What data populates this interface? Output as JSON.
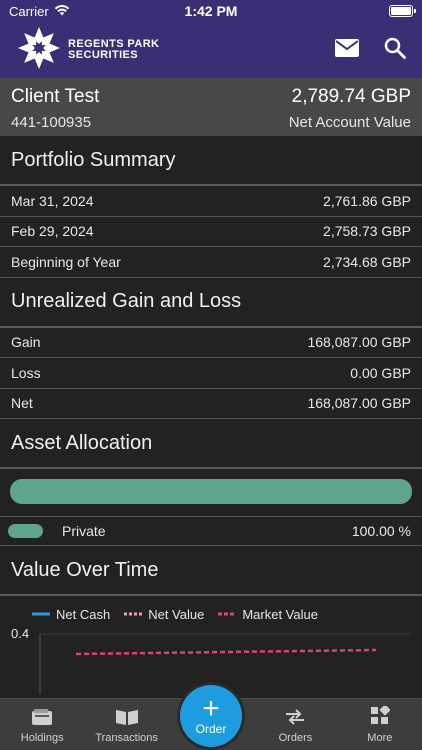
{
  "status": {
    "carrier": "Carrier",
    "time": "1:42 PM"
  },
  "brand": {
    "line1": "REGENTS PARK",
    "line2": "SECURITIES"
  },
  "header": {
    "icons": [
      "mail-icon",
      "search-icon"
    ]
  },
  "client": {
    "name": "Client Test",
    "account_id": "441-100935",
    "value": "2,789.74 GBP",
    "value_caption": "Net Account Value"
  },
  "portfolio": {
    "title": "Portfolio Summary",
    "rows": [
      {
        "label": "Mar 31, 2024",
        "value": "2,761.86 GBP"
      },
      {
        "label": "Feb 29, 2024",
        "value": "2,758.73 GBP"
      },
      {
        "label": "Beginning of Year",
        "value": "2,734.68 GBP"
      }
    ]
  },
  "gain_loss": {
    "title": "Unrealized Gain and Loss",
    "rows": [
      {
        "label": "Gain",
        "value": "168,087.00 GBP"
      },
      {
        "label": "Loss",
        "value": "0.00 GBP"
      },
      {
        "label": "Net",
        "value": "168,087.00 GBP"
      }
    ]
  },
  "allocation": {
    "title": "Asset Allocation",
    "items": [
      {
        "label": "Private",
        "percent": "100.00 %",
        "color": "#5fa58b",
        "fraction": 1.0
      }
    ]
  },
  "value_over_time": {
    "title": "Value Over Time",
    "legend": [
      {
        "label": "Net Cash",
        "color": "#2a9be0",
        "style": "solid"
      },
      {
        "label": "Net Value",
        "color": "#e8a0b4",
        "style": "dotted"
      },
      {
        "label": "Market Value",
        "color": "#e0446a",
        "style": "dashed"
      }
    ],
    "y_tick": "0.4"
  },
  "tabs": [
    {
      "label": "Holdings",
      "icon": "wallet-icon"
    },
    {
      "label": "Transactions",
      "icon": "book-icon"
    },
    {
      "label": "Orders",
      "icon": "arrows-icon"
    },
    {
      "label": "More",
      "icon": "grid-icon"
    }
  ],
  "order_button": {
    "label": "Order",
    "symbol": "+"
  },
  "colors": {
    "brand": "#3a2f74",
    "accent": "#1e9ce0",
    "allocation": "#5fa58b"
  }
}
